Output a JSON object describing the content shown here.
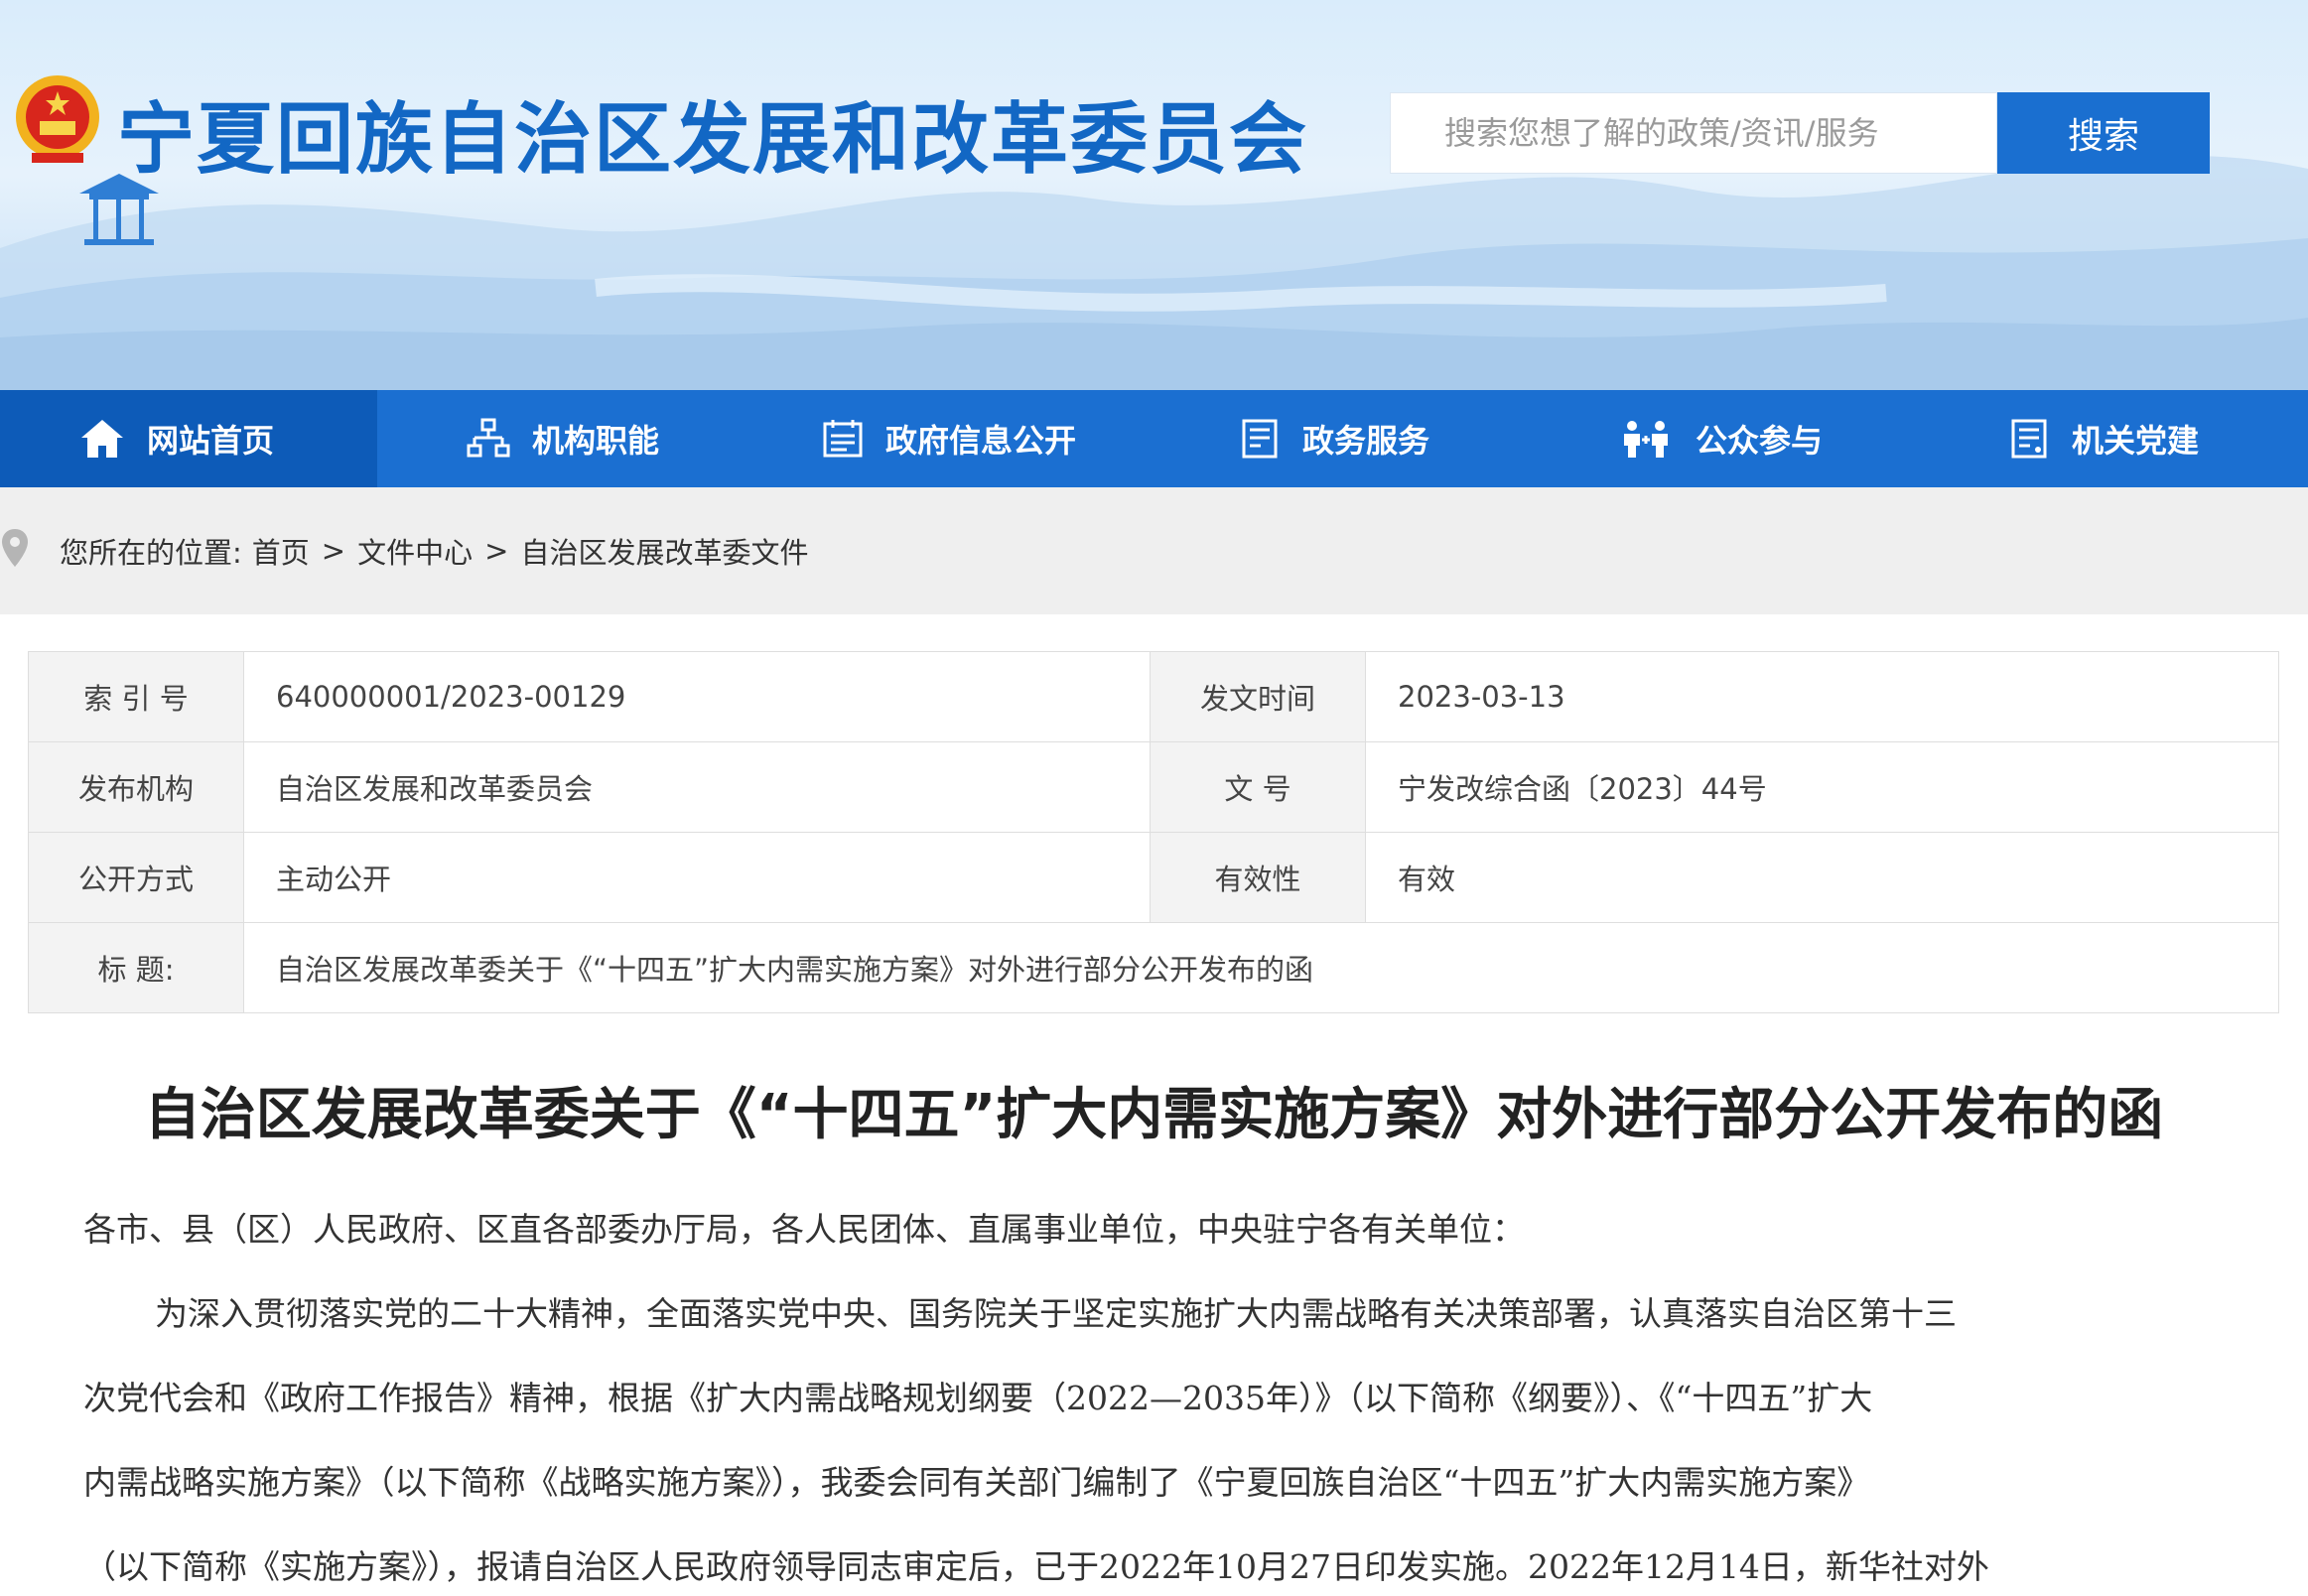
{
  "header": {
    "site_title": "宁夏回族自治区发展和改革委员会",
    "search_placeholder": "搜索您想了解的政策/资讯/服务",
    "search_button": "搜索"
  },
  "nav": {
    "items": [
      {
        "label": "网站首页",
        "icon": "home-icon",
        "active": true
      },
      {
        "label": "机构职能",
        "icon": "org-chart-icon"
      },
      {
        "label": "政府信息公开",
        "icon": "calendar-doc-icon"
      },
      {
        "label": "政务服务",
        "icon": "document-icon"
      },
      {
        "label": "公众参与",
        "icon": "people-icon"
      },
      {
        "label": "机关党建",
        "icon": "list-doc-icon"
      }
    ]
  },
  "breadcrumb": {
    "prefix": "您所在的位置:",
    "items": [
      "首页",
      "文件中心",
      "自治区发展改革委文件"
    ],
    "separator": ">"
  },
  "meta": {
    "index_label": "索 引 号",
    "index_value": "640000001/2023-00129",
    "date_label": "发文时间",
    "date_value": "2023-03-13",
    "publisher_label": "发布机构",
    "publisher_value": "自治区发展和改革委员会",
    "docno_label": "文 号",
    "docno_value": "宁发改综合函〔2023〕44号",
    "mode_label": "公开方式",
    "mode_value": "主动公开",
    "validity_label": "有效性",
    "validity_value": "有效",
    "title_label": "标 题:",
    "title_value": "自治区发展改革委关于《“十四五”扩大内需实施方案》对外进行部分公开发布的函"
  },
  "article": {
    "title": "自治区发展改革委关于《“十四五”扩大内需实施方案》对外进行部分公开发布的函",
    "lines": [
      "各市、县（区）人民政府、区直各部委办厅局，各人民团体、直属事业单位，中央驻宁各有关单位：",
      "为深入贯彻落实党的二十大精神，全面落实党中央、国务院关于坚定实施扩大内需战略有关决策部署，认真落实自治区第十三",
      "次党代会和《政府工作报告》精神，根据《扩大内需战略规划纲要（2022—2035年）》（以下简称《纲要》）、《“十四五”扩大",
      "内需战略实施方案》（以下简称《战略实施方案》），我委会同有关部门编制了《宁夏回族自治区“十四五”扩大内需实施方案》",
      "（以下简称《实施方案》），报请自治区人民政府领导同志审定后，已于2022年10月27日印发实施。2022年12月14日，新华社对外"
    ]
  },
  "colors": {
    "brand_blue": "#1b6fd1",
    "title_blue": "#1267c4"
  }
}
